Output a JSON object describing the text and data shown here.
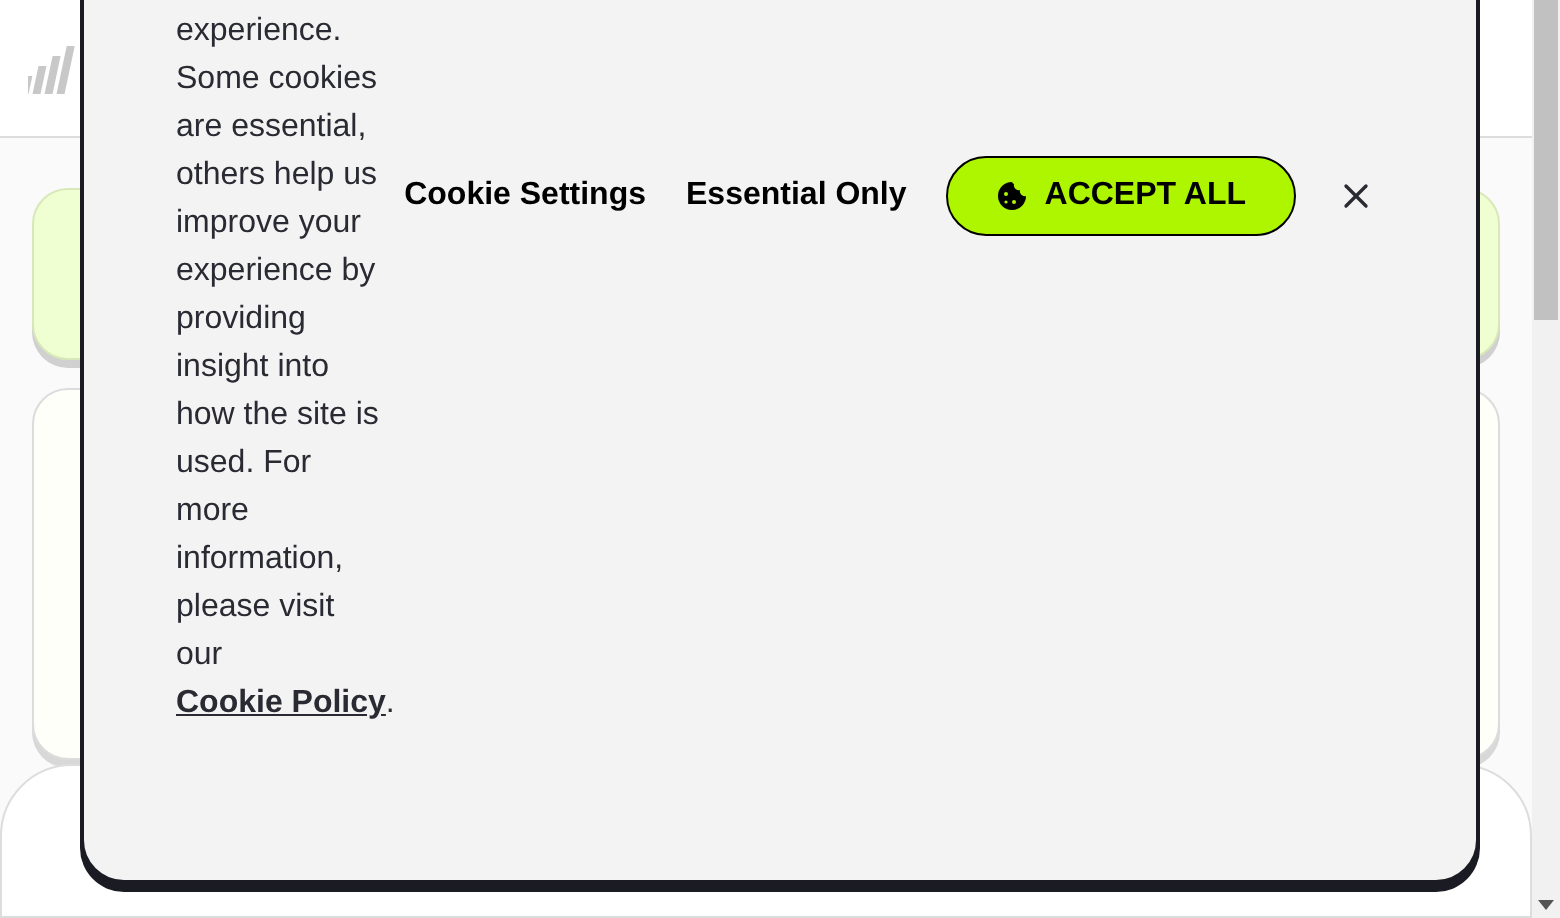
{
  "cookie_banner": {
    "message": {
      "before": "experience. Some cookies are essential, others help us improve your experience by providing insight into how the site is used. For more information, please visit our ",
      "link": "Cookie Policy",
      "after": "."
    },
    "buttons": [
      {
        "label": "Cookie Settings",
        "kind": "text"
      },
      {
        "label": "Essential Only",
        "kind": "text"
      },
      {
        "label": "ACCEPT ALL",
        "kind": "primary"
      }
    ]
  }
}
